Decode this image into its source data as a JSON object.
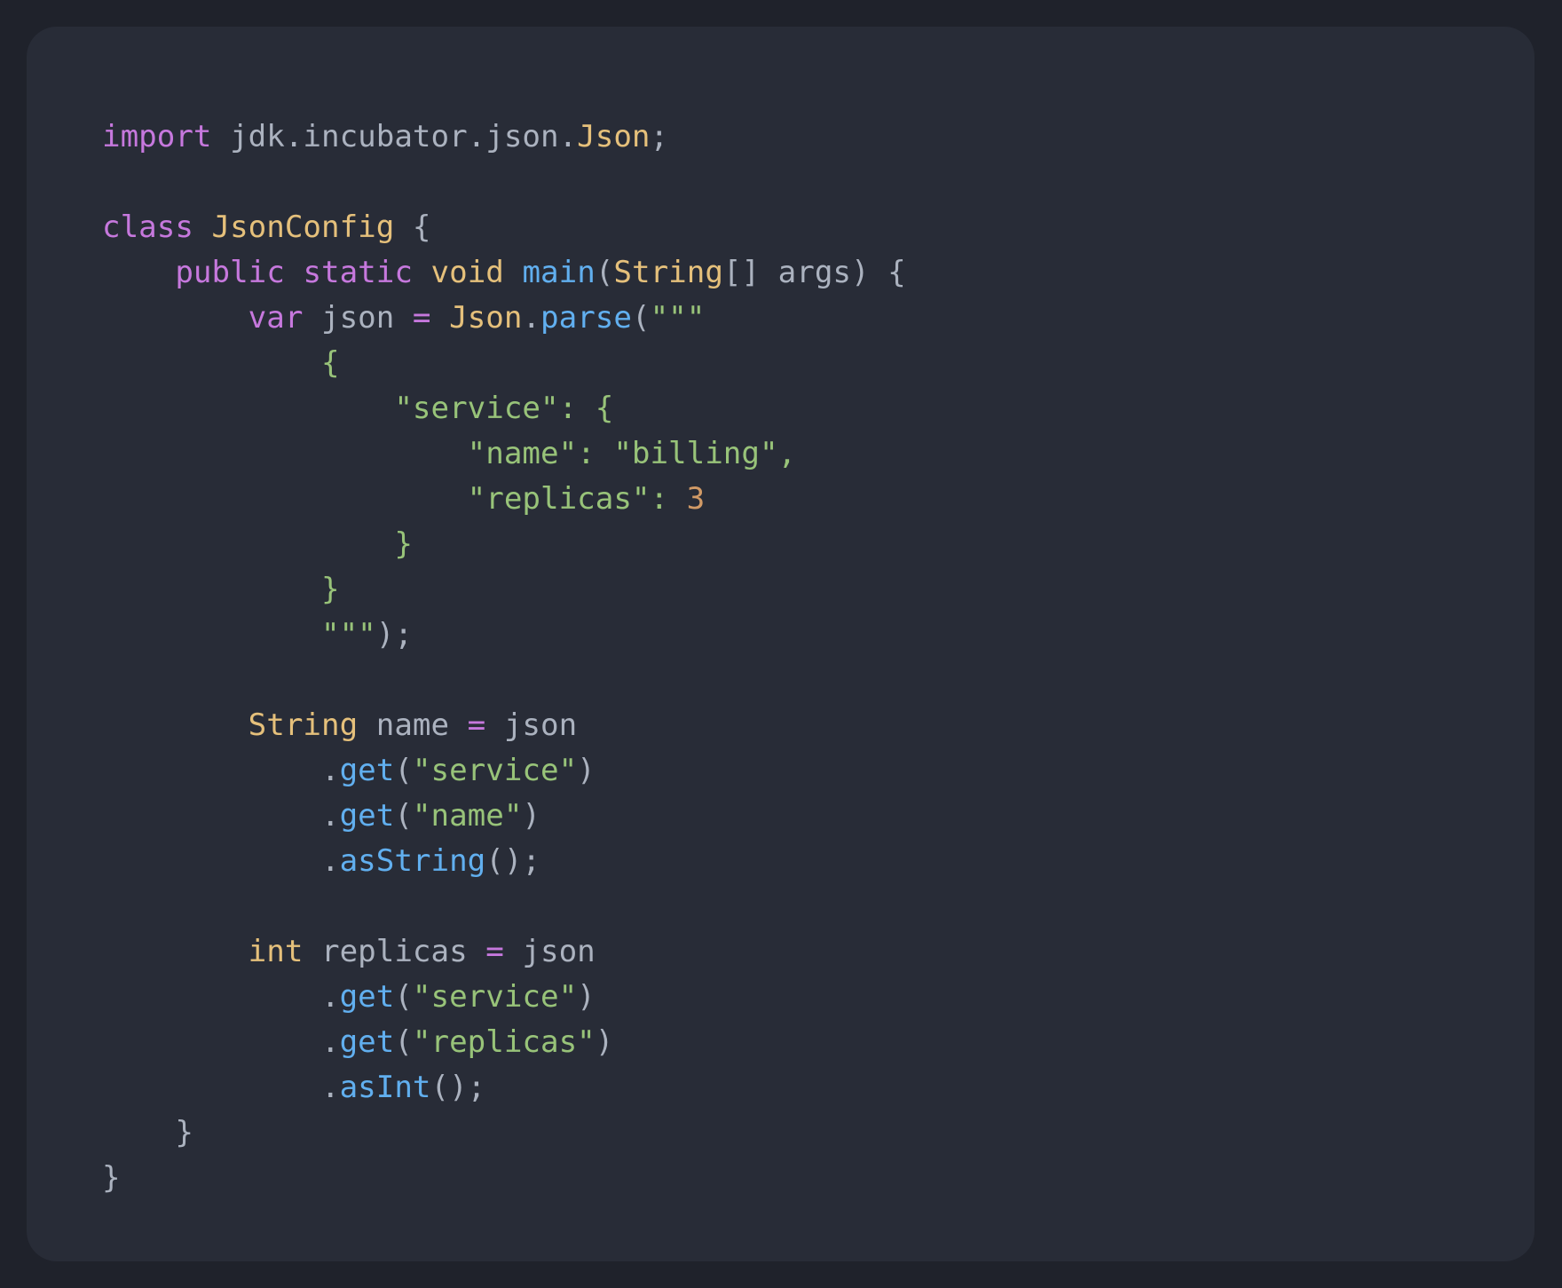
{
  "theme": {
    "page_background": "#1f222b",
    "card_background": "#282c37",
    "default_text": "#abb2bf",
    "colors": {
      "keyword": "#c678dd",
      "type": "#e5c07b",
      "function": "#61afef",
      "string": "#98c379",
      "number": "#d19a66",
      "plain": "#abb2bf"
    }
  },
  "code": {
    "language": "java",
    "lines": [
      [
        {
          "t": "import",
          "k": "keyword"
        },
        {
          "t": " jdk.incubator.json.",
          "k": "plain"
        },
        {
          "t": "Json",
          "k": "type"
        },
        {
          "t": ";",
          "k": "plain"
        }
      ],
      [],
      [
        {
          "t": "class",
          "k": "keyword"
        },
        {
          "t": " ",
          "k": "plain"
        },
        {
          "t": "JsonConfig",
          "k": "type"
        },
        {
          "t": " {",
          "k": "plain"
        }
      ],
      [
        {
          "t": "    ",
          "k": "plain"
        },
        {
          "t": "public",
          "k": "keyword"
        },
        {
          "t": " ",
          "k": "plain"
        },
        {
          "t": "static",
          "k": "keyword"
        },
        {
          "t": " ",
          "k": "plain"
        },
        {
          "t": "void",
          "k": "type"
        },
        {
          "t": " ",
          "k": "plain"
        },
        {
          "t": "main",
          "k": "function"
        },
        {
          "t": "(",
          "k": "plain"
        },
        {
          "t": "String",
          "k": "type"
        },
        {
          "t": "[] args) {",
          "k": "plain"
        }
      ],
      [
        {
          "t": "        ",
          "k": "plain"
        },
        {
          "t": "var",
          "k": "keyword"
        },
        {
          "t": " json ",
          "k": "plain"
        },
        {
          "t": "=",
          "k": "keyword"
        },
        {
          "t": " ",
          "k": "plain"
        },
        {
          "t": "Json",
          "k": "type"
        },
        {
          "t": ".",
          "k": "plain"
        },
        {
          "t": "parse",
          "k": "function"
        },
        {
          "t": "(",
          "k": "plain"
        },
        {
          "t": "\"\"\"",
          "k": "string"
        }
      ],
      [
        {
          "t": "            {",
          "k": "string"
        }
      ],
      [
        {
          "t": "                \"service\": {",
          "k": "string"
        }
      ],
      [
        {
          "t": "                    \"name\": \"billing\",",
          "k": "string"
        }
      ],
      [
        {
          "t": "                    \"replicas\": ",
          "k": "string"
        },
        {
          "t": "3",
          "k": "number"
        }
      ],
      [
        {
          "t": "                }",
          "k": "string"
        }
      ],
      [
        {
          "t": "            }",
          "k": "string"
        }
      ],
      [
        {
          "t": "            \"\"\"",
          "k": "string"
        },
        {
          "t": ");",
          "k": "plain"
        }
      ],
      [],
      [
        {
          "t": "        ",
          "k": "plain"
        },
        {
          "t": "String",
          "k": "type"
        },
        {
          "t": " name ",
          "k": "plain"
        },
        {
          "t": "=",
          "k": "keyword"
        },
        {
          "t": " json",
          "k": "plain"
        }
      ],
      [
        {
          "t": "            .",
          "k": "plain"
        },
        {
          "t": "get",
          "k": "function"
        },
        {
          "t": "(",
          "k": "plain"
        },
        {
          "t": "\"service\"",
          "k": "string"
        },
        {
          "t": ")",
          "k": "plain"
        }
      ],
      [
        {
          "t": "            .",
          "k": "plain"
        },
        {
          "t": "get",
          "k": "function"
        },
        {
          "t": "(",
          "k": "plain"
        },
        {
          "t": "\"name\"",
          "k": "string"
        },
        {
          "t": ")",
          "k": "plain"
        }
      ],
      [
        {
          "t": "            .",
          "k": "plain"
        },
        {
          "t": "asString",
          "k": "function"
        },
        {
          "t": "();",
          "k": "plain"
        }
      ],
      [],
      [
        {
          "t": "        ",
          "k": "plain"
        },
        {
          "t": "int",
          "k": "type"
        },
        {
          "t": " replicas ",
          "k": "plain"
        },
        {
          "t": "=",
          "k": "keyword"
        },
        {
          "t": " json",
          "k": "plain"
        }
      ],
      [
        {
          "t": "            .",
          "k": "plain"
        },
        {
          "t": "get",
          "k": "function"
        },
        {
          "t": "(",
          "k": "plain"
        },
        {
          "t": "\"service\"",
          "k": "string"
        },
        {
          "t": ")",
          "k": "plain"
        }
      ],
      [
        {
          "t": "            .",
          "k": "plain"
        },
        {
          "t": "get",
          "k": "function"
        },
        {
          "t": "(",
          "k": "plain"
        },
        {
          "t": "\"replicas\"",
          "k": "string"
        },
        {
          "t": ")",
          "k": "plain"
        }
      ],
      [
        {
          "t": "            .",
          "k": "plain"
        },
        {
          "t": "asInt",
          "k": "function"
        },
        {
          "t": "();",
          "k": "plain"
        }
      ],
      [
        {
          "t": "    }",
          "k": "plain"
        }
      ],
      [
        {
          "t": "}",
          "k": "plain"
        }
      ]
    ]
  }
}
